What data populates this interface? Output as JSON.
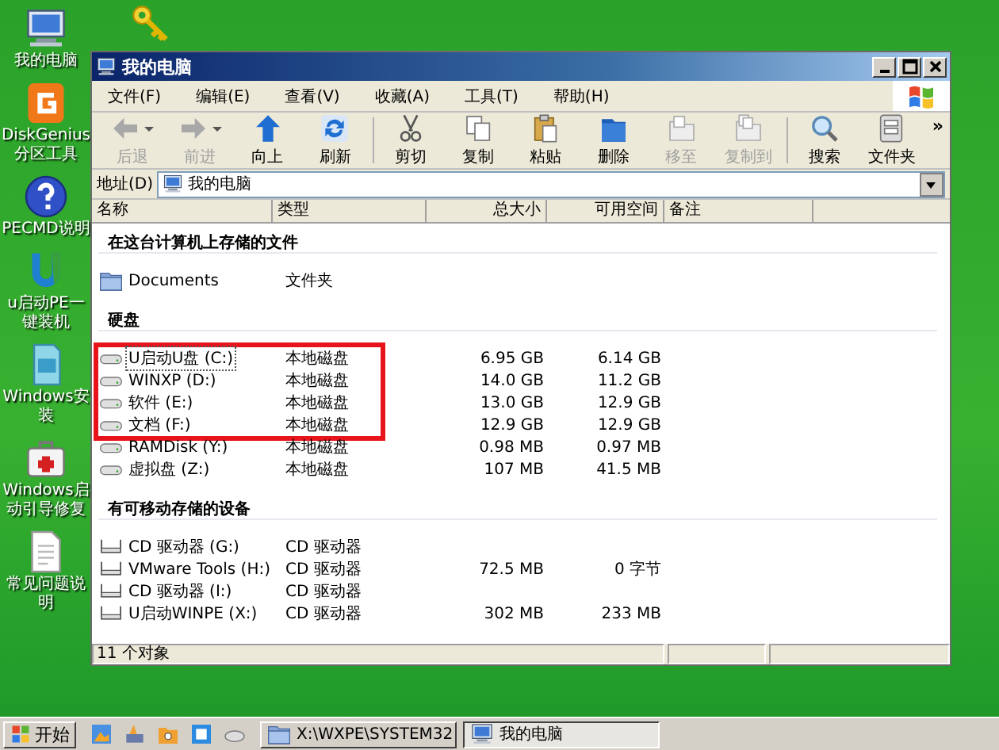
{
  "desktop_icons": [
    {
      "kind": "computer",
      "label": "我的电脑"
    },
    {
      "kind": "diskgenius",
      "label": "DiskGenius分区工具"
    },
    {
      "kind": "help",
      "label": "PECMD说明"
    },
    {
      "kind": "installer",
      "label": "u启动PE一键装机"
    },
    {
      "kind": "setup",
      "label": "Windows安装"
    },
    {
      "kind": "repair",
      "label": "Windows启动引导修复"
    },
    {
      "kind": "document",
      "label": "常见问题说明"
    }
  ],
  "window": {
    "title": "我的电脑",
    "menu": [
      "文件(F)",
      "编辑(E)",
      "查看(V)",
      "收藏(A)",
      "工具(T)",
      "帮助(H)"
    ],
    "toolbar": [
      {
        "kind": "back",
        "label": "后退",
        "disabled": true,
        "dropdown": true
      },
      {
        "kind": "forward",
        "label": "前进",
        "disabled": true,
        "dropdown": true
      },
      {
        "kind": "up",
        "label": "向上",
        "disabled": false,
        "dropdown": false
      },
      {
        "kind": "refresh",
        "label": "刷新",
        "disabled": false,
        "dropdown": false
      },
      {
        "kind": "separator"
      },
      {
        "kind": "cut",
        "label": "剪切",
        "disabled": false,
        "dropdown": false
      },
      {
        "kind": "copy",
        "label": "复制",
        "disabled": false,
        "dropdown": false
      },
      {
        "kind": "paste",
        "label": "粘贴",
        "disabled": false,
        "dropdown": false
      },
      {
        "kind": "delete",
        "label": "删除",
        "disabled": false,
        "dropdown": false
      },
      {
        "kind": "moveto",
        "label": "移至",
        "disabled": true,
        "dropdown": false
      },
      {
        "kind": "copyto",
        "label": "复制到",
        "disabled": true,
        "dropdown": false
      },
      {
        "kind": "separator"
      },
      {
        "kind": "search",
        "label": "搜索",
        "disabled": false,
        "dropdown": false
      },
      {
        "kind": "folders",
        "label": "文件夹",
        "disabled": false,
        "dropdown": false
      }
    ],
    "toolbar_overflow": "»",
    "address": {
      "label": "地址(D)",
      "value": "我的电脑"
    },
    "columns": [
      "名称",
      "类型",
      "总大小",
      "可用空间",
      "备注"
    ],
    "groups": [
      {
        "heading": "在这台计算机上存储的文件",
        "items": [
          {
            "kind": "folder",
            "name": "Documents",
            "type": "文件夹",
            "selected": false,
            "highlighted": false
          }
        ]
      },
      {
        "heading": "硬盘",
        "items": [
          {
            "kind": "disk",
            "name": "U启动U盘 (C:)",
            "type": "本地磁盘",
            "total": "6.95 GB",
            "free": "6.14 GB",
            "selected": true,
            "highlighted": true
          },
          {
            "kind": "disk",
            "name": "WINXP (D:)",
            "type": "本地磁盘",
            "total": "14.0 GB",
            "free": "11.2 GB",
            "selected": false,
            "highlighted": true
          },
          {
            "kind": "disk",
            "name": "软件 (E:)",
            "type": "本地磁盘",
            "total": "13.0 GB",
            "free": "12.9 GB",
            "selected": false,
            "highlighted": true
          },
          {
            "kind": "disk",
            "name": "文档 (F:)",
            "type": "本地磁盘",
            "total": "12.9 GB",
            "free": "12.9 GB",
            "selected": false,
            "highlighted": true
          },
          {
            "kind": "disk",
            "name": "RAMDisk (Y:)",
            "type": "本地磁盘",
            "total": "0.98 MB",
            "free": "0.97 MB",
            "selected": false,
            "highlighted": false
          },
          {
            "kind": "disk",
            "name": "虚拟盘 (Z:)",
            "type": "本地磁盘",
            "total": "107 MB",
            "free": "41.5 MB",
            "selected": false,
            "highlighted": false
          }
        ]
      },
      {
        "heading": "有可移动存储的设备",
        "items": [
          {
            "kind": "cd",
            "name": "CD 驱动器 (G:)",
            "type": "CD 驱动器",
            "selected": false,
            "highlighted": false
          },
          {
            "kind": "cd",
            "name": "VMware Tools (H:)",
            "type": "CD 驱动器",
            "total": "72.5 MB",
            "free": "0 字节",
            "selected": false,
            "highlighted": false
          },
          {
            "kind": "cd",
            "name": "CD 驱动器 (I:)",
            "type": "CD 驱动器",
            "selected": false,
            "highlighted": false
          },
          {
            "kind": "cd",
            "name": "U启动WINPE (X:)",
            "type": "CD 驱动器",
            "total": "302 MB",
            "free": "233 MB",
            "selected": false,
            "highlighted": false
          }
        ]
      }
    ],
    "status_bar": [
      "11 个对象"
    ]
  },
  "taskbar": {
    "start": "开始",
    "tasks": [
      {
        "kind": "folder",
        "label": "X:\\WXPE\\SYSTEM32",
        "selected": false
      },
      {
        "kind": "computer",
        "label": "我的电脑",
        "selected": true
      }
    ]
  }
}
